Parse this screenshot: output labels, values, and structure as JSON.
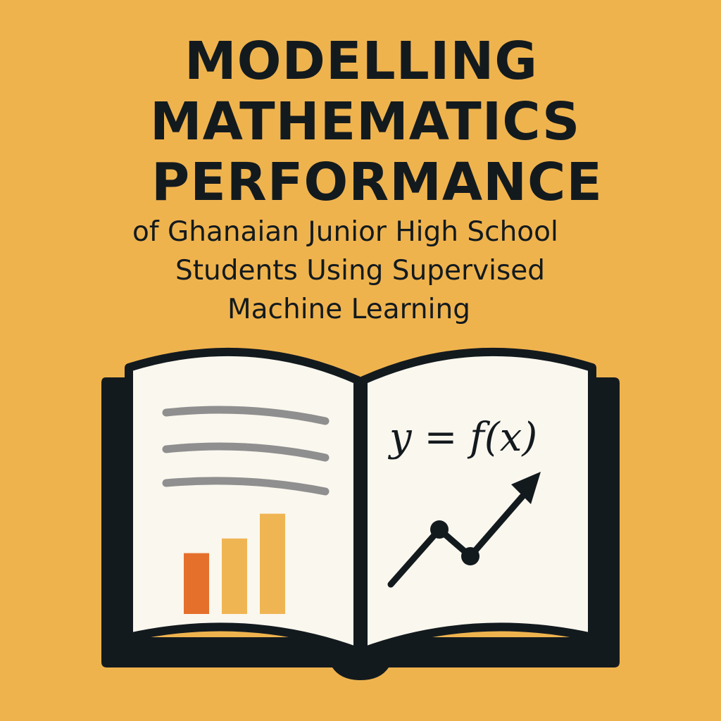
{
  "colors": {
    "background": "#efb34e",
    "ink": "#131a1e",
    "page": "#faf7ee",
    "text_lines": "#8f8f8f",
    "bar_orange": "#e5702c",
    "bar_yellow": "#f0b553"
  },
  "title": {
    "line1": "MODELLING",
    "line2": "MATHEMATICS",
    "line3": "PERFORMANCE"
  },
  "subtitle": {
    "line1": "of Ghanaian Junior High School",
    "line2": "Students Using Supervised",
    "line3": "Machine Learning"
  },
  "book": {
    "formula": "y = f(x)",
    "icons": [
      "text-lines-icon",
      "bar-chart-icon",
      "trend-arrow-icon"
    ],
    "bar_chart_relative_values": [
      0.54,
      0.67,
      0.89
    ]
  }
}
